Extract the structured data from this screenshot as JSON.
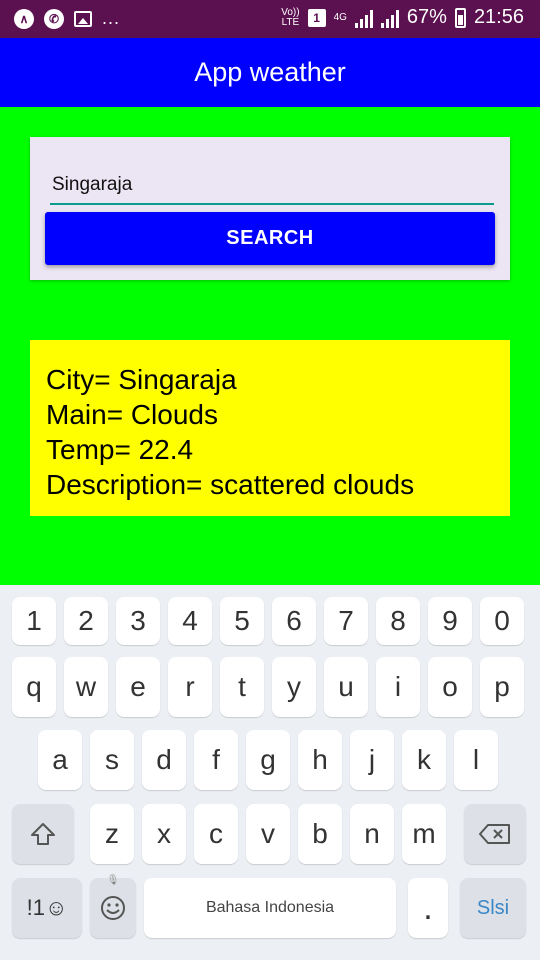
{
  "status_bar": {
    "time": "21:56",
    "battery": "67%",
    "volte": "Vo)) LTE",
    "sim": "1",
    "network": "4G",
    "more": "..."
  },
  "app": {
    "title": "App weather"
  },
  "search": {
    "city_value": "Singaraja",
    "button_label": "SEARCH"
  },
  "result": {
    "city": "City= Singaraja",
    "main": "Main= Clouds",
    "temp": "Temp= 22.4",
    "description": "Description= scattered clouds"
  },
  "keyboard": {
    "row_numbers": [
      "1",
      "2",
      "3",
      "4",
      "5",
      "6",
      "7",
      "8",
      "9",
      "0"
    ],
    "row_1": [
      "q",
      "w",
      "e",
      "r",
      "t",
      "y",
      "u",
      "i",
      "o",
      "p"
    ],
    "row_2": [
      "a",
      "s",
      "d",
      "f",
      "g",
      "h",
      "j",
      "k",
      "l"
    ],
    "row_3": [
      "z",
      "x",
      "c",
      "v",
      "b",
      "n",
      "m"
    ],
    "symbols_label": "!1☺",
    "space_label": "Bahasa Indonesia",
    "period_label": ".",
    "action_label": "Slsi"
  },
  "colors": {
    "status_bar": "#5b1050",
    "app_bar": "#0000ff",
    "background": "#00ff00",
    "result_box": "#ffff00",
    "button": "#0000ff"
  }
}
